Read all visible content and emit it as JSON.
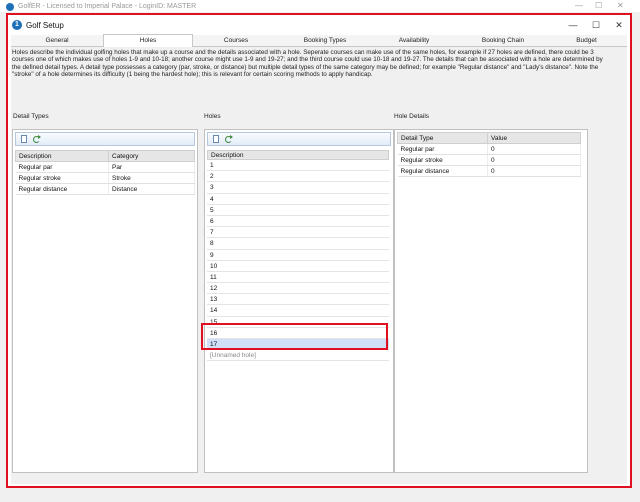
{
  "outer_window": {
    "title": "GolfER - Licensed to Imperial Palace - LoginID: MASTER",
    "controls": [
      "—",
      "☐",
      "✕"
    ]
  },
  "window": {
    "title": "Golf Setup",
    "app_icon": "golf-app-icon",
    "controls": {
      "minimize": "—",
      "maximize": "☐",
      "close": "✕"
    }
  },
  "tabs": [
    {
      "label": "General",
      "active": false
    },
    {
      "label": "Holes",
      "active": true
    },
    {
      "label": "Courses",
      "active": false
    },
    {
      "label": "Booking Types",
      "active": false
    },
    {
      "label": "Availability",
      "active": false
    },
    {
      "label": "Booking Chain",
      "active": false
    },
    {
      "label": "Budget",
      "active": false
    }
  ],
  "description": "Holes describe the individual golfing holes that make up a course and the details associated with a hole. Seperate courses can make use of the same holes, for example if 27 holes are defined, there could be 3 courses one of which makes use of holes 1-9 and 10-18; another course might use 1-9 and 19-27; and the third course could use 10-18 and 19-27. The details that can be associated with a hole are determined by the defined detail types. A detail type possesses a category (par, stroke, or distance) but multiple detail types of the same category may be defined; for example \"Regular distance\" and \"Lady's distance\". Note the \"stroke\" of a hole determines its difficulty (1 being the hardest hole); this is relevant for certain scoring methods to apply handicap.",
  "detail_types": {
    "label": "Detail Types",
    "columns": [
      "Description",
      "Category"
    ],
    "rows": [
      [
        "Regular par",
        "Par"
      ],
      [
        "Regular stroke",
        "Stroke"
      ],
      [
        "Regular distance",
        "Distance"
      ]
    ]
  },
  "holes": {
    "label": "Holes",
    "column": "Description",
    "items": [
      "1",
      "2",
      "3",
      "4",
      "5",
      "6",
      "7",
      "8",
      "9",
      "10",
      "11",
      "12",
      "13",
      "14",
      "15",
      "16",
      "17"
    ],
    "selected": "17",
    "new_item_placeholder": "[Unnamed hole]"
  },
  "hole_details": {
    "label": "Hole Details",
    "columns": [
      "Detail Type",
      "Value"
    ],
    "rows": [
      [
        "Regular par",
        "0"
      ],
      [
        "Regular stroke",
        "0"
      ],
      [
        "Regular distance",
        "0"
      ]
    ]
  },
  "colors": {
    "highlight_border": "#e01020",
    "selection": "#cfe0f8",
    "app_icon": "#1d6fb8"
  }
}
